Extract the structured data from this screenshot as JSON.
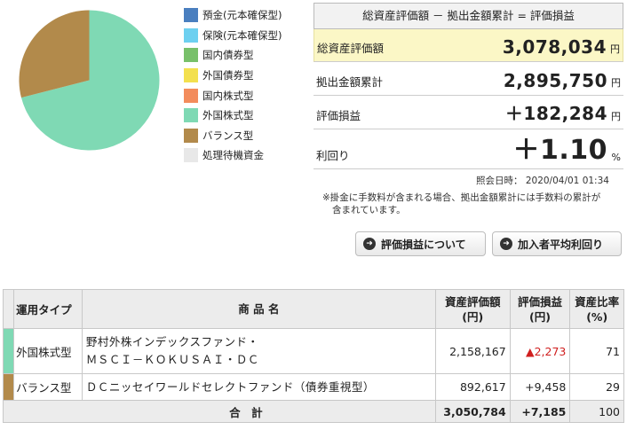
{
  "legend": [
    {
      "label": "預金(元本確保型)",
      "color": "#4a7fbf"
    },
    {
      "label": "保険(元本確保型)",
      "color": "#6dd0f0"
    },
    {
      "label": "国内債券型",
      "color": "#78c06a"
    },
    {
      "label": "外国債券型",
      "color": "#f3e04e"
    },
    {
      "label": "国内株式型",
      "color": "#f38c5c"
    },
    {
      "label": "外国株式型",
      "color": "#7fd9b4"
    },
    {
      "label": "バランス型",
      "color": "#b28a4b"
    },
    {
      "label": "処理待機資金",
      "color": "#e8e8e8"
    }
  ],
  "chart_data": {
    "type": "pie",
    "slices": [
      {
        "label": "外国株式型",
        "value": 71,
        "color": "#7fd9b4"
      },
      {
        "label": "バランス型",
        "value": 29,
        "color": "#b28a4b"
      }
    ]
  },
  "summary": {
    "header": "総資産評価額 － 拠出金額累計 = 評価損益",
    "rows": [
      {
        "label": "総資産評価額",
        "value": "3,078,034",
        "unit": "円"
      },
      {
        "label": "拠出金額累計",
        "value": "2,895,750",
        "unit": "円"
      },
      {
        "label": "評価損益",
        "value": "＋182,284",
        "unit": "円"
      },
      {
        "label": "利回り",
        "value": "＋1.10",
        "unit": "%"
      }
    ]
  },
  "timestamp": "照会日時： 2020/04/01 01:34",
  "note": {
    "line1": "※掛金に手数料が含まれる場合、拠出金額累計には手数料の累計が",
    "line2": "含まれています。"
  },
  "buttons": {
    "about_gain": "評価損益について",
    "avg_yield": "加入者平均利回り"
  },
  "table": {
    "headers": {
      "type": "運用タイプ",
      "name": "商 品 名",
      "value_l1": "資産評価額",
      "value_l2": "(円)",
      "gain_l1": "評価損益",
      "gain_l2": "(円)",
      "ratio_l1": "資産比率",
      "ratio_l2": "(%)"
    },
    "rows": [
      {
        "type": "外国株式型",
        "color": "#7fd9b4",
        "name_l1": "野村外株インデックスファンド・",
        "name_l2": "ＭＳＣＩ－ＫＯＫＵＳＡＩ・ＤＣ",
        "value": "2,158,167",
        "gain": "▲2,273",
        "ratio": "71"
      },
      {
        "type": "バランス型",
        "color": "#b28a4b",
        "name_l1": "ＤＣニッセイワールドセレクトファンド（債券重視型）",
        "name_l2": "",
        "value": "892,617",
        "gain": "+9,458",
        "ratio": "29"
      }
    ],
    "total": {
      "label": "合　計",
      "value": "3,050,784",
      "gain": "+7,185",
      "ratio": "100"
    }
  }
}
